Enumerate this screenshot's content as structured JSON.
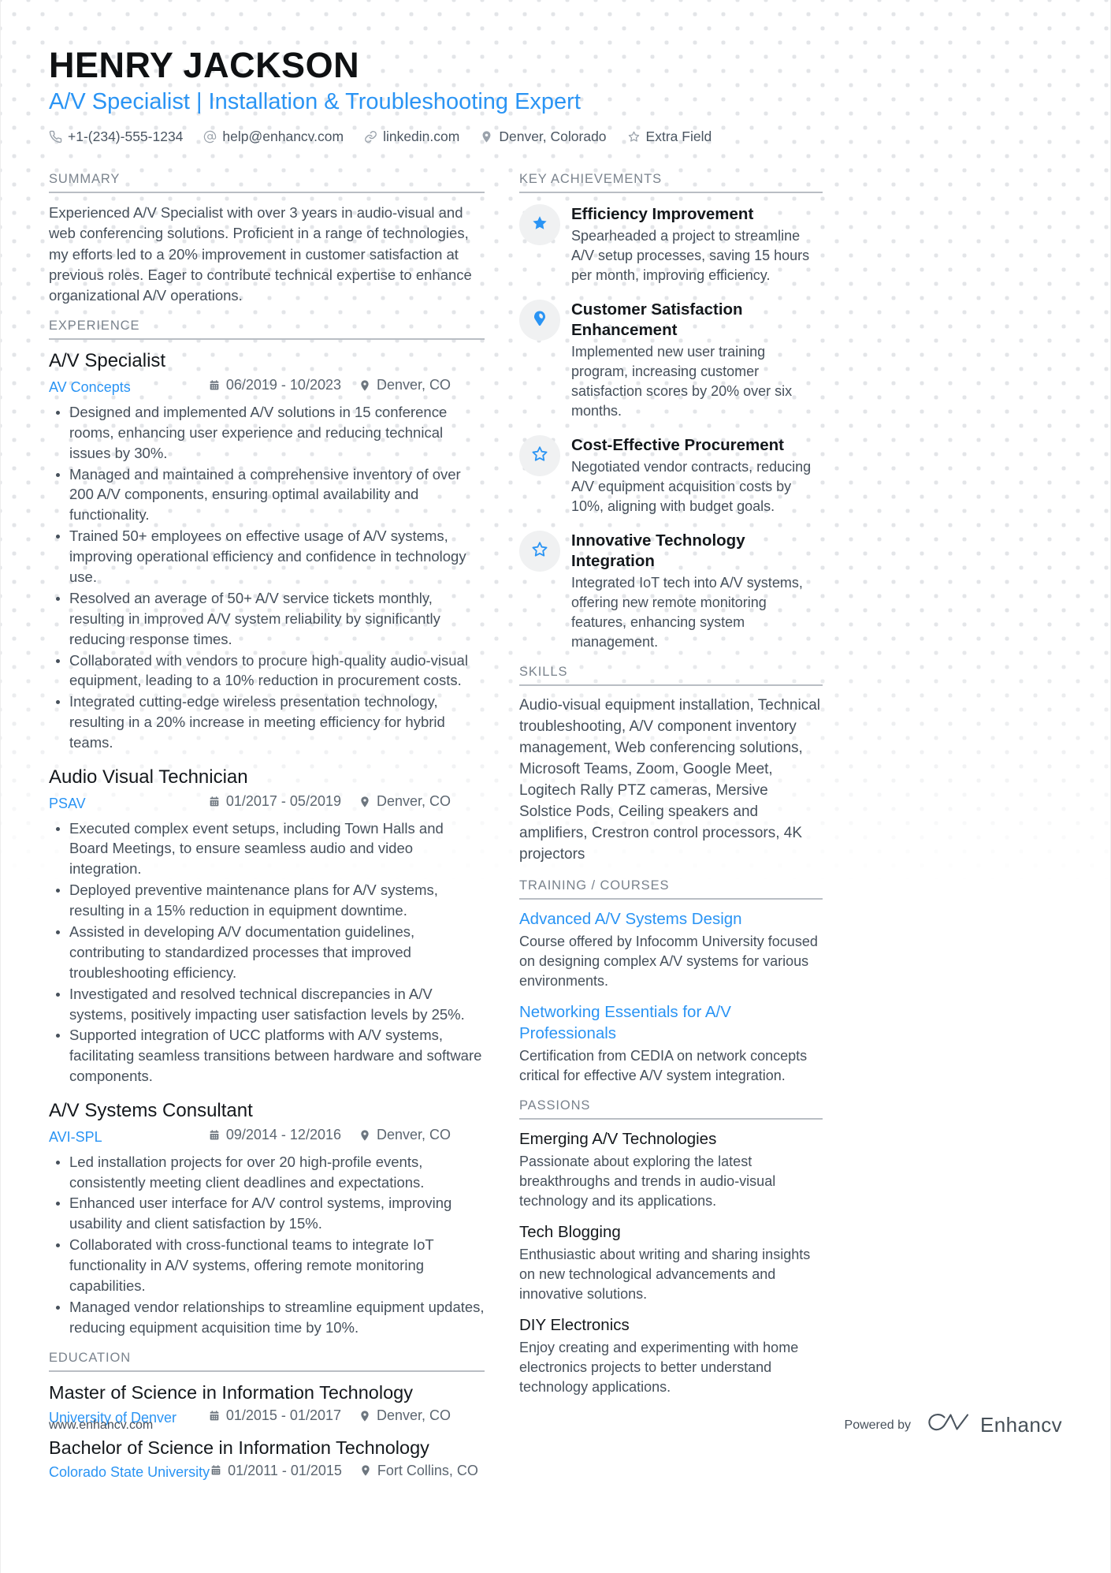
{
  "header": {
    "full_name": "HENRY JACKSON",
    "job_title": "A/V Specialist | Installation & Troubleshooting Expert",
    "contacts": [
      {
        "icon": "phone-icon",
        "value": "+1-(234)-555-1234"
      },
      {
        "icon": "email-icon",
        "value": "help@enhancv.com"
      },
      {
        "icon": "link-icon",
        "value": "linkedin.com"
      },
      {
        "icon": "location-pin-icon",
        "value": "Denver, Colorado"
      },
      {
        "icon": "star-outline-icon",
        "value": "Extra Field"
      }
    ]
  },
  "left": {
    "summary": {
      "heading": "SUMMARY",
      "text": "Experienced A/V Specialist with over 3 years in audio-visual and web conferencing solutions. Proficient in a range of technologies, my efforts led to a 20% improvement in customer satisfaction at previous roles. Eager to contribute technical expertise to enhance organizational A/V operations."
    },
    "experience": {
      "heading": "EXPERIENCE",
      "entries": [
        {
          "title": "A/V Specialist",
          "company": "AV Concepts",
          "dates": "06/2019 - 10/2023",
          "location": "Denver, CO",
          "bullets": [
            "Designed and implemented A/V solutions in 15 conference rooms, enhancing user experience and reducing technical issues by 30%.",
            "Managed and maintained a comprehensive inventory of over 200 A/V components, ensuring optimal availability and functionality.",
            "Trained 50+ employees on effective usage of A/V systems, improving operational efficiency and confidence in technology use.",
            "Resolved an average of 50+ A/V service tickets monthly, resulting in improved A/V system reliability by significantly reducing response times.",
            "Collaborated with vendors to procure high-quality audio-visual equipment, leading to a 10% reduction in procurement costs.",
            "Integrated cutting-edge wireless presentation technology, resulting in a 20% increase in meeting efficiency for hybrid teams."
          ]
        },
        {
          "title": "Audio Visual Technician",
          "company": "PSAV",
          "dates": "01/2017 - 05/2019",
          "location": "Denver, CO",
          "bullets": [
            "Executed complex event setups, including Town Halls and Board Meetings, to ensure seamless audio and video integration.",
            "Deployed preventive maintenance plans for A/V systems, resulting in a 15% reduction in equipment downtime.",
            "Assisted in developing A/V documentation guidelines, contributing to standardized processes that improved troubleshooting efficiency.",
            "Investigated and resolved technical discrepancies in A/V systems, positively impacting user satisfaction levels by 25%.",
            "Supported integration of UCC platforms with A/V systems, facilitating seamless transitions between hardware and software components."
          ]
        },
        {
          "title": "A/V Systems Consultant",
          "company": "AVI-SPL",
          "dates": "09/2014 - 12/2016",
          "location": "Denver, CO",
          "bullets": [
            "Led installation projects for over 20 high-profile events, consistently meeting client deadlines and expectations.",
            "Enhanced user interface for A/V control systems, improving usability and client satisfaction by 15%.",
            "Collaborated with cross-functional teams to integrate IoT functionality in A/V systems, offering remote monitoring capabilities.",
            "Managed vendor relationships to streamline equipment updates, reducing equipment acquisition time by 10%."
          ]
        }
      ]
    },
    "education": {
      "heading": "EDUCATION",
      "entries": [
        {
          "title": "Master of Science in Information Technology",
          "school": "University of Denver",
          "dates": "01/2015 - 01/2017",
          "location": "Denver, CO"
        },
        {
          "title": "Bachelor of Science in Information Technology",
          "school": "Colorado State University",
          "dates": "01/2011 - 01/2015",
          "location": "Fort Collins, CO"
        }
      ]
    }
  },
  "right": {
    "achievements": {
      "heading": "KEY ACHIEVEMENTS",
      "items": [
        {
          "icon": "star-filled-icon",
          "title": "Efficiency Improvement",
          "desc": "Spearheaded a project to streamline A/V setup processes, saving 15 hours per month, improving efficiency."
        },
        {
          "icon": "pin-filled-icon",
          "title": "Customer Satisfaction Enhancement",
          "desc": "Implemented new user training program, increasing customer satisfaction scores by 20% over six months."
        },
        {
          "icon": "star-outline-icon",
          "title": "Cost-Effective Procurement",
          "desc": "Negotiated vendor contracts, reducing A/V equipment acquisition costs by 10%, aligning with budget goals."
        },
        {
          "icon": "star-outline-icon",
          "title": "Innovative Technology Integration",
          "desc": "Integrated IoT tech into A/V systems, offering new remote monitoring features, enhancing system management."
        }
      ]
    },
    "skills": {
      "heading": "SKILLS",
      "text": "Audio-visual equipment installation, Technical troubleshooting, A/V component inventory management, Web conferencing solutions, Microsoft Teams, Zoom, Google Meet, Logitech Rally PTZ cameras, Mersive Solstice Pods, Ceiling speakers and amplifiers, Crestron control processors, 4K projectors"
    },
    "training": {
      "heading": "TRAINING / COURSES",
      "items": [
        {
          "title": "Advanced A/V Systems Design",
          "desc": "Course offered by Infocomm University focused on designing complex A/V systems for various environments."
        },
        {
          "title": "Networking Essentials for A/V Professionals",
          "desc": "Certification from CEDIA on network concepts critical for effective A/V system integration."
        }
      ]
    },
    "passions": {
      "heading": "PASSIONS",
      "items": [
        {
          "title": "Emerging A/V Technologies",
          "desc": "Passionate about exploring the latest breakthroughs and trends in audio-visual technology and its applications."
        },
        {
          "title": "Tech Blogging",
          "desc": "Enthusiastic about writing and sharing insights on new technological advancements and innovative solutions."
        },
        {
          "title": "DIY Electronics",
          "desc": "Enjoy creating and experimenting with home electronics projects to better understand technology applications."
        }
      ]
    }
  },
  "footer": {
    "url": "www.enhancv.com",
    "powered_by": "Powered by",
    "brand": "Enhancv"
  },
  "colors": {
    "accent_blue": "#2a94f4",
    "heading_gray": "#7a838d",
    "body_text": "#46505b",
    "badge_bg": "#f0f1f2"
  }
}
